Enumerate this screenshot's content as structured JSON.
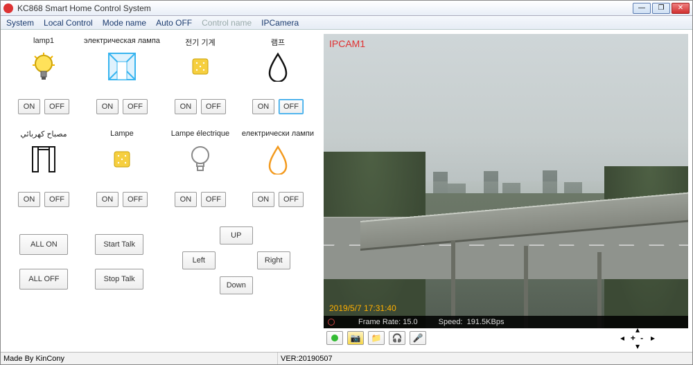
{
  "window": {
    "title": "KC868 Smart Home Control System"
  },
  "menu": {
    "system": "System",
    "local": "Local Control",
    "mode": "Mode name",
    "auto": "Auto OFF",
    "control": "Control name",
    "ipcam": "IPCamera"
  },
  "labels": {
    "on": "ON",
    "off": "OFF"
  },
  "devices": [
    {
      "name": "lamp1",
      "icon": "bulb-yellow"
    },
    {
      "name": "электрическая лампа",
      "icon": "window-blue"
    },
    {
      "name": "전기 기계",
      "icon": "square-yellow"
    },
    {
      "name": "램프",
      "icon": "droplet-black",
      "off_selected": true
    },
    {
      "name": "مصباح كهربائي",
      "icon": "gate"
    },
    {
      "name": "Lampe",
      "icon": "square-yellow"
    },
    {
      "name": "Lampe électrique",
      "icon": "bulb-outline"
    },
    {
      "name": "електрически лампи",
      "icon": "droplet-orange"
    }
  ],
  "actions": {
    "all_on": "ALL ON",
    "all_off": "ALL OFF",
    "start_talk": "Start Talk",
    "stop_talk": "Stop Talk",
    "up": "UP",
    "down": "Down",
    "left": "Left",
    "right": "Right"
  },
  "camera": {
    "label": "IPCAM1",
    "timestamp": "2019/5/7 17:31:40",
    "frame_rate_label": "Frame Rate:",
    "frame_rate": "15.0",
    "speed_label": "Speed:",
    "speed": "191.5KBps"
  },
  "ptz": {
    "plus": "+",
    "minus": "-"
  },
  "status": {
    "made_by": "Made By KinCony",
    "ver": "VER:20190507"
  }
}
